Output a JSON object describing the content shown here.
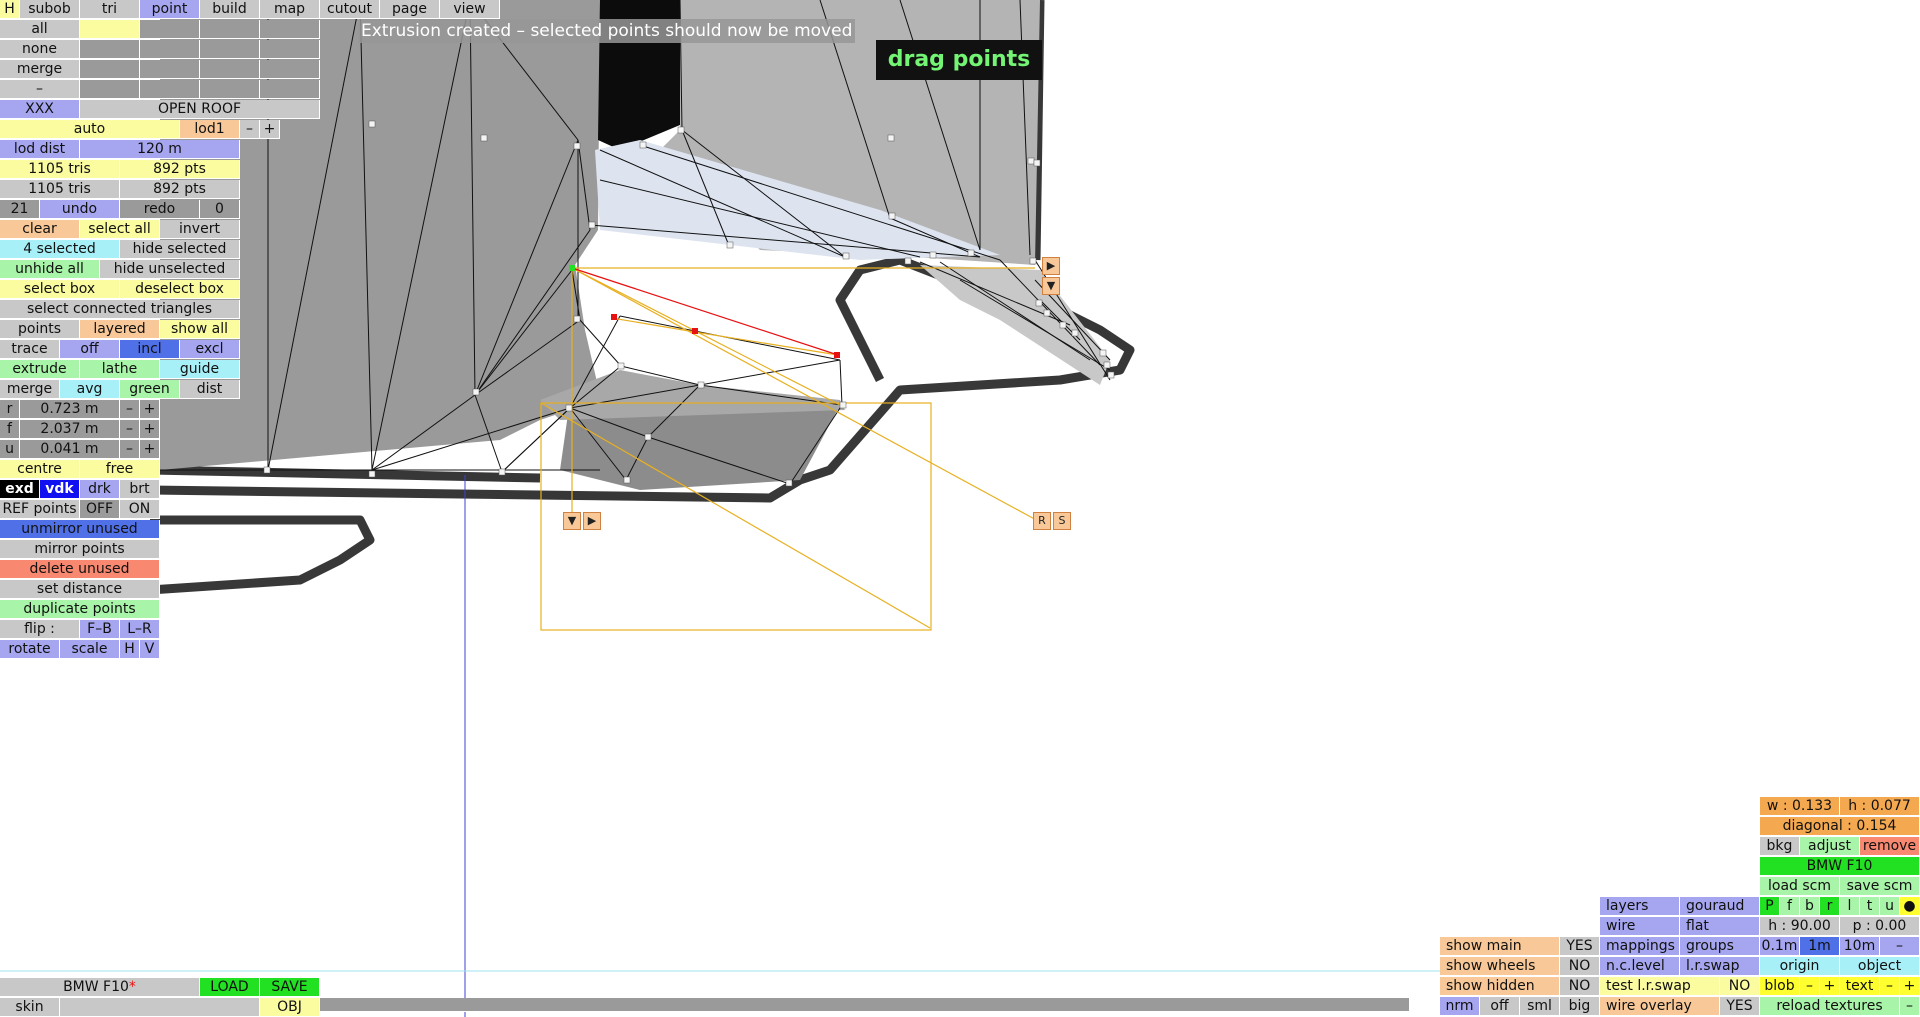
{
  "overlay": {
    "status": "Extrusion created – selected points should now be moved",
    "mode_badge": "drag points"
  },
  "tabs": {
    "h": "H",
    "subob": "subob",
    "tri": "tri",
    "point": "point",
    "build": "build",
    "map": "map",
    "cutout": "cutout",
    "page": "page",
    "view": "view"
  },
  "left": {
    "all": "all",
    "none": "none",
    "merge": "merge",
    "dash": "–",
    "xxx": "XXX",
    "open_roof": "OPEN ROOF",
    "auto": "auto",
    "lod1": "lod1",
    "minus": "–",
    "plus": "+",
    "lod_dist": "lod dist",
    "lod_dist_val": "120 m",
    "tris1": "1105 tris",
    "pts1": "892 pts",
    "tris2": "1105 tris",
    "pts2": "892 pts",
    "undo_count": "21",
    "undo": "undo",
    "redo": "redo",
    "redo_count": "0",
    "clear": "clear",
    "select_all": "select all",
    "invert": "invert",
    "selected": "4 selected",
    "hide_selected": "hide selected",
    "unhide_all": "unhide all",
    "hide_unselected": "hide unselected",
    "select_box": "select box",
    "deselect_box": "deselect box",
    "select_connected": "select connected triangles",
    "points": "points",
    "layered": "layered",
    "show_all": "show all",
    "trace": "trace",
    "off": "off",
    "incl": "incl",
    "excl": "excl",
    "extrude": "extrude",
    "lathe": "lathe",
    "guide": "guide",
    "merge2": "merge",
    "avg": "avg",
    "green": "green",
    "dist": "dist",
    "r": "r",
    "r_val": "0.723 m",
    "f": "f",
    "f_val": "2.037 m",
    "u": "u",
    "u_val": "0.041 m",
    "centre": "centre",
    "free": "free",
    "exd": "exd",
    "vdk": "vdk",
    "drk": "drk",
    "brt": "brt",
    "ref_points": "REF points",
    "ref_off": "OFF",
    "ref_on": "ON",
    "unmirror_unused": "unmirror unused",
    "mirror_points": "mirror points",
    "delete_unused": "delete unused",
    "set_distance": "set distance",
    "duplicate_points": "duplicate points",
    "flip": "flip :",
    "fb": "F–B",
    "lr": "L–R",
    "rotate": "rotate",
    "scale": "scale",
    "hh": "H",
    "vv": "V"
  },
  "handles": {
    "down": "▼",
    "right": "▶",
    "r": "R",
    "s": "S"
  },
  "bottom": {
    "file": "BMW F10",
    "asterisk": "*",
    "load": "LOAD",
    "save": "SAVE",
    "skin": "skin",
    "obj": "OBJ"
  },
  "right": {
    "w": "w : 0.133",
    "h": "h : 0.077",
    "diagonal": "diagonal : 0.154",
    "bkg": "bkg",
    "adjust": "adjust",
    "remove": "remove",
    "title": "BMW F10",
    "load_scm": "load scm",
    "save_scm": "save scm",
    "views": [
      "P",
      "f",
      "b",
      "r",
      "l",
      "t",
      "u",
      "●"
    ],
    "heading": "h : 90.00",
    "pitch": "p : 0.00",
    "s01": "0.1m",
    "s1": "1m",
    "s10": "10m",
    "sminus": "–",
    "origin": "origin",
    "object": "object",
    "blob": "blob",
    "text": "text",
    "minus": "–",
    "plus": "+",
    "reload": "reload textures",
    "rminus": "–",
    "layers": "layers",
    "gouraud": "gouraud",
    "wire": "wire",
    "flat": "flat",
    "mappings": "mappings",
    "groups": "groups",
    "nc_level": "n.c.level",
    "lr_swap": "l.r.swap",
    "test_lr": "test l.r.swap",
    "test_no": "NO",
    "wire_overlay": "wire overlay",
    "wo_yes": "YES",
    "show_main": "show main",
    "sm_val": "YES",
    "show_wheels": "show wheels",
    "sw_val": "NO",
    "show_hidden": "show hidden",
    "sh_val": "NO",
    "nrm": "nrm",
    "off": "off",
    "sml": "sml",
    "big": "big"
  },
  "colors": {
    "selected_point": "#e81010",
    "active_point": "#22e022",
    "guide": "#e8b020",
    "axis": "#4040d0"
  }
}
